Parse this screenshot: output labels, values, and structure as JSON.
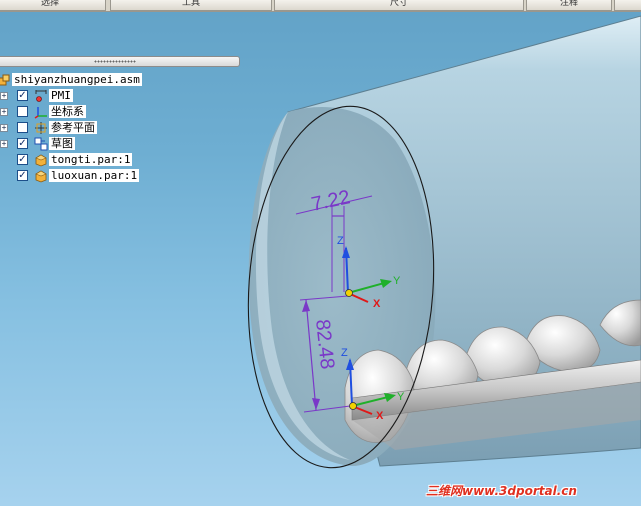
{
  "ribbon": {
    "tabs": [
      "选择",
      "工具",
      "尺寸",
      "注释"
    ]
  },
  "tree": {
    "root": {
      "label": "shiyanzhuangpei.asm",
      "icon": "assembly-icon"
    },
    "items": [
      {
        "label": "PMI",
        "checked": true,
        "expandable": true,
        "icon": "pmi-icon"
      },
      {
        "label": "坐标系",
        "checked": false,
        "expandable": true,
        "icon": "coordinate-system-icon"
      },
      {
        "label": "参考平面",
        "checked": false,
        "expandable": true,
        "icon": "reference-plane-icon"
      },
      {
        "label": "草图",
        "checked": true,
        "expandable": true,
        "icon": "sketch-icon"
      },
      {
        "label": "tongti.par:1",
        "checked": true,
        "expandable": false,
        "icon": "part-icon"
      },
      {
        "label": "luoxuan.par:1",
        "checked": true,
        "expandable": false,
        "icon": "part-icon"
      }
    ]
  },
  "viewport": {
    "dimensions": {
      "horizontal": "7.22",
      "vertical": "82.48"
    },
    "axes": {
      "z": "Z",
      "y": "Y",
      "x": "X"
    },
    "colors": {
      "dimension": "#7a38c8",
      "cylinder": "#9fc4d6",
      "axis_z": "#1f4fe0",
      "axis_y": "#1fb02a",
      "axis_x": "#e01818"
    }
  },
  "watermark": "三维网www.3dportal.cn"
}
